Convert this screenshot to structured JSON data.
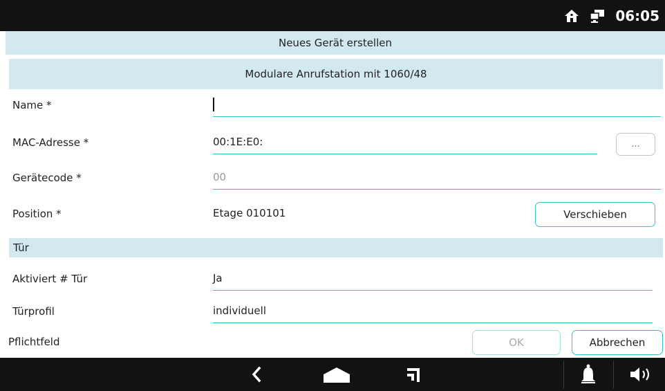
{
  "status": {
    "time": "06:05",
    "icons": [
      "home-icon",
      "network-icon"
    ]
  },
  "header": {
    "title": "Neues Gerät erstellen",
    "subtitle": "Modulare Anrufstation mit 1060/48"
  },
  "form": {
    "name": {
      "label": "Name *",
      "value": ""
    },
    "mac": {
      "label": "MAC-Adresse *",
      "value": "00:1E:E0:",
      "button": "..."
    },
    "device_code": {
      "label": "Gerätecode *",
      "placeholder": "00"
    },
    "position": {
      "label": "Position *",
      "value": "Etage 010101",
      "button": "Verschieben"
    },
    "section_door": "Tür",
    "activated_door": {
      "label": "Aktiviert # Tür",
      "value": "Ja"
    },
    "door_profile": {
      "label": "Türprofil",
      "value": "individuell"
    }
  },
  "footer": {
    "required_note": "Pflichtfeld",
    "ok": "OK",
    "cancel": "Abbrechen"
  },
  "navbar": {
    "icons": [
      "back-icon",
      "home-icon",
      "recent-apps-icon",
      "bell-icon",
      "volume-icon"
    ]
  },
  "colors": {
    "accent": "#39c1c6",
    "band": "#d3e9f0",
    "bar": "#121212"
  }
}
